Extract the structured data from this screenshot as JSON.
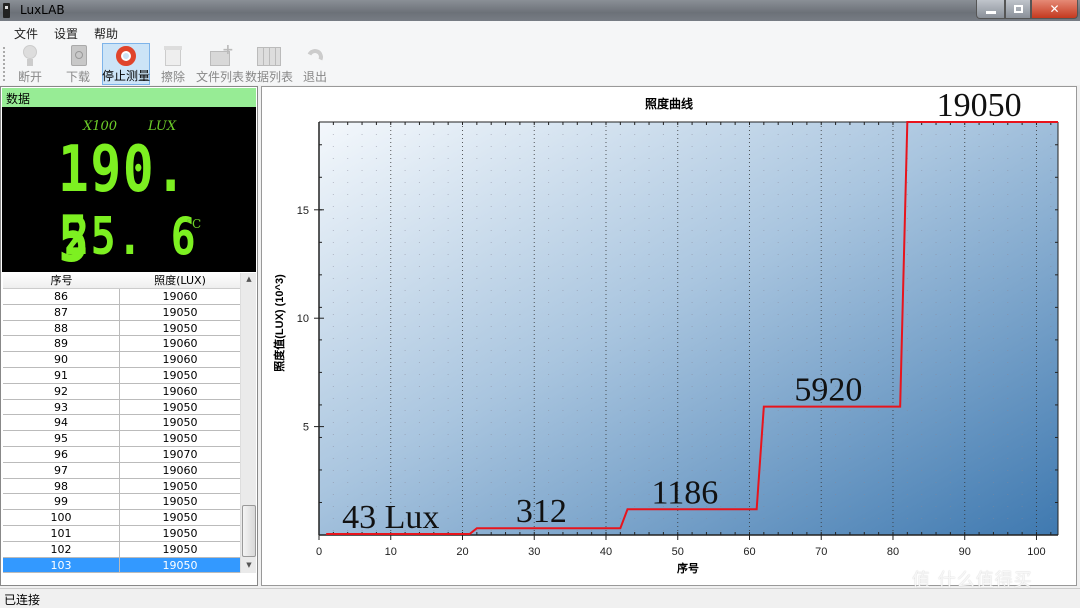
{
  "window": {
    "title": "LuxLAB",
    "controls": [
      "minimize",
      "restore",
      "close"
    ]
  },
  "menu": [
    "文件",
    "设置",
    "帮助"
  ],
  "toolbar": [
    {
      "label": "断开",
      "icon": "bulb-icon",
      "active": false
    },
    {
      "label": "下载",
      "icon": "address-book-icon",
      "active": false
    },
    {
      "label": "停止测量",
      "icon": "lifebuoy-icon",
      "active": true
    },
    {
      "label": "擦除",
      "icon": "recycle-bin-icon",
      "active": false
    },
    {
      "label": "文件列表",
      "icon": "folder-add-icon",
      "active": false
    },
    {
      "label": "数据列表",
      "icon": "data-grid-icon",
      "active": false
    },
    {
      "label": "退出",
      "icon": "redo-arrow-icon",
      "active": false
    }
  ],
  "data_panel": {
    "header": "数据",
    "multiplier": "X100",
    "unit": "LUX",
    "lux_reading": "190. 5",
    "temperature": "25. 6",
    "temp_unit": "°C"
  },
  "table": {
    "columns": [
      "序号",
      "照度(LUX)"
    ],
    "rows": [
      [
        "86",
        "19060"
      ],
      [
        "87",
        "19050"
      ],
      [
        "88",
        "19050"
      ],
      [
        "89",
        "19060"
      ],
      [
        "90",
        "19060"
      ],
      [
        "91",
        "19050"
      ],
      [
        "92",
        "19060"
      ],
      [
        "93",
        "19050"
      ],
      [
        "94",
        "19050"
      ],
      [
        "95",
        "19050"
      ],
      [
        "96",
        "19070"
      ],
      [
        "97",
        "19060"
      ],
      [
        "98",
        "19050"
      ],
      [
        "99",
        "19050"
      ],
      [
        "100",
        "19050"
      ],
      [
        "101",
        "19050"
      ],
      [
        "102",
        "19050"
      ],
      [
        "103",
        "19050"
      ]
    ],
    "selected_row": "103"
  },
  "status": "已连接",
  "watermark": "值 什么值得买",
  "chart_data": {
    "type": "line",
    "title": "照度曲线",
    "xlabel": "序号",
    "ylabel": "照度值(LUX) (10^3)",
    "xlim": [
      0,
      103
    ],
    "ylim": [
      0,
      19.05
    ],
    "xticks": [
      0,
      10,
      20,
      30,
      40,
      50,
      60,
      70,
      80,
      90,
      100
    ],
    "yticks": [
      5,
      10,
      15
    ],
    "grid": true,
    "line_color": "#e8141c",
    "series": [
      {
        "name": "照度",
        "x": [
          1,
          21,
          22,
          42,
          43,
          61,
          62,
          81,
          82,
          103
        ],
        "y": [
          0.043,
          0.043,
          0.312,
          0.312,
          1.186,
          1.186,
          5.92,
          5.92,
          19.05,
          19.05
        ]
      }
    ],
    "annotations": [
      {
        "text": "43  Lux",
        "x": 10,
        "y": 0.043
      },
      {
        "text": "312",
        "x": 31,
        "y": 0.312
      },
      {
        "text": "1186",
        "x": 51,
        "y": 1.186
      },
      {
        "text": "5920",
        "x": 71,
        "y": 5.92
      },
      {
        "text": "19050",
        "x": 92,
        "y": 19.05
      }
    ]
  }
}
